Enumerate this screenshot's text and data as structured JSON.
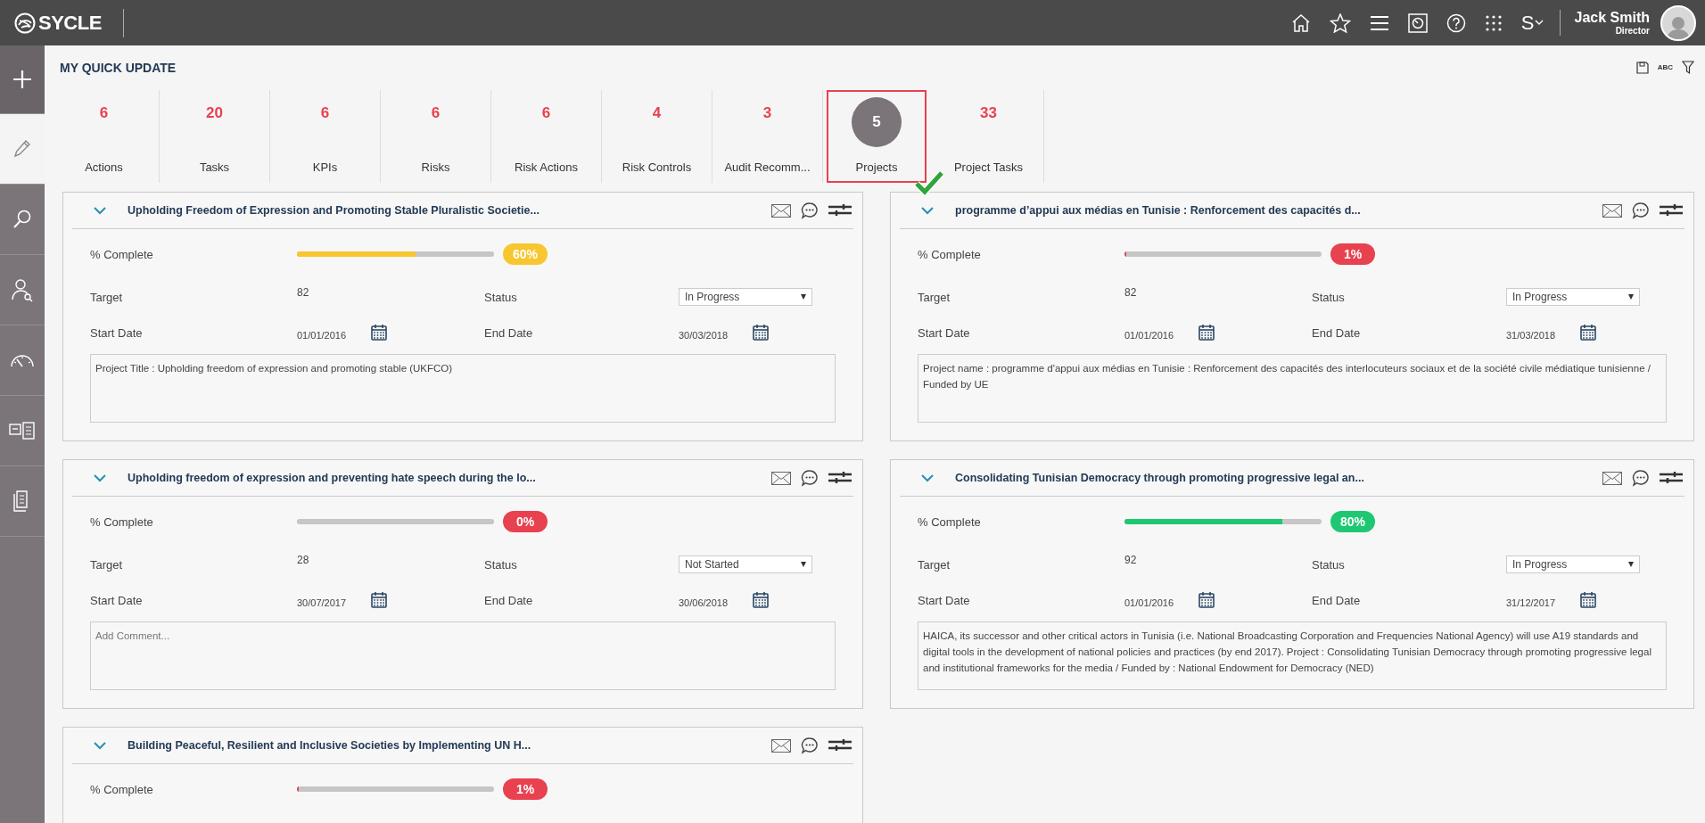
{
  "header": {
    "logo": "SYCLE",
    "switch_label": "S",
    "user": {
      "name": "Jack Smith",
      "role": "Director"
    }
  },
  "sidebar": {
    "items": [
      {
        "kind": "plus",
        "selected": false
      },
      {
        "kind": "pencil",
        "selected": true
      },
      {
        "kind": "search",
        "selected": false
      },
      {
        "kind": "person",
        "selected": false
      },
      {
        "kind": "gauge",
        "selected": false
      },
      {
        "kind": "layout",
        "selected": false
      },
      {
        "kind": "document",
        "selected": false
      }
    ]
  },
  "page_title": "MY QUICK UPDATE",
  "toolbar": {
    "spellcheck_text": "ABC"
  },
  "tabs": [
    {
      "count": "6",
      "label": "Actions",
      "selected": false
    },
    {
      "count": "20",
      "label": "Tasks",
      "selected": false
    },
    {
      "count": "6",
      "label": "KPIs",
      "selected": false
    },
    {
      "count": "6",
      "label": "Risks",
      "selected": false
    },
    {
      "count": "6",
      "label": "Risk Actions",
      "selected": false
    },
    {
      "count": "4",
      "label": "Risk Controls",
      "selected": false
    },
    {
      "count": "3",
      "label": "Audit Recomm...",
      "selected": false
    },
    {
      "count": "5",
      "label": "Projects",
      "selected": true
    },
    {
      "count": "33",
      "label": "Project Tasks",
      "selected": false
    }
  ],
  "cards": [
    {
      "title": "Upholding Freedom of Expression and Promoting Stable Pluralistic Societie...",
      "complete_label": "% Complete",
      "level": 0.6,
      "percent": "60%",
      "color": "#f8c630",
      "target_label": "Target",
      "target": "82",
      "status_label": "Status",
      "status": "In Progress",
      "start_label": "Start Date",
      "start_date": "01/01/2016",
      "end_label": "End Date",
      "end_date": "30/03/2018",
      "comment": "Project Title : Upholding freedom of expression and promoting stable (UKFCO)"
    },
    {
      "title": "programme d’appui aux médias en Tunisie : Renforcement des capacités d...",
      "complete_label": "% Complete",
      "level": 0.01,
      "percent": "1%",
      "color": "#e8414f",
      "target_label": "Target",
      "target": "82",
      "status_label": "Status",
      "status": "In Progress",
      "start_label": "Start Date",
      "start_date": "01/01/2016",
      "end_label": "End Date",
      "end_date": "31/03/2018",
      "comment": "Project name : programme d'appui aux médias en Tunisie :  Renforcement des capacités des interlocuteurs sociaux et de la société civile médiatique tunisienne / Funded by UE"
    },
    {
      "title": "Upholding freedom of expression and preventing hate speech during the lo...",
      "complete_label": "% Complete",
      "level": 0,
      "percent": "0%",
      "color": "#e8414f",
      "target_label": "Target",
      "target": "28",
      "status_label": "Status",
      "status": "Not Started",
      "start_label": "Start Date",
      "start_date": "30/07/2017",
      "end_label": "End Date",
      "end_date": "30/06/2018",
      "placeholder": "Add Comment..."
    },
    {
      "title": "Consolidating Tunisian Democracy through promoting progressive legal an...",
      "complete_label": "% Complete",
      "level": 0.8,
      "percent": "80%",
      "color": "#1ec872",
      "target_label": "Target",
      "target": "92",
      "status_label": "Status",
      "status": "In Progress",
      "start_label": "Start Date",
      "start_date": "01/01/2016",
      "end_label": "End Date",
      "end_date": "31/12/2017",
      "comment": "HAICA, its successor and other critical actors in Tunisia (i.e. National Broadcasting Corporation and Frequencies National Agency) will use A19 standards and digital tools in the development of national policies and practices (by end 2017). Project : Consolidating Tunisian Democracy through promoting progressive legal and institutional frameworks for the media / Funded by : National Endowment for Democracy (NED)"
    },
    {
      "title": "Building Peaceful, Resilient and Inclusive Societies by Implementing UN H...",
      "complete_label": "% Complete",
      "level": 0.01,
      "percent": "1%",
      "color": "#e8414f"
    }
  ]
}
